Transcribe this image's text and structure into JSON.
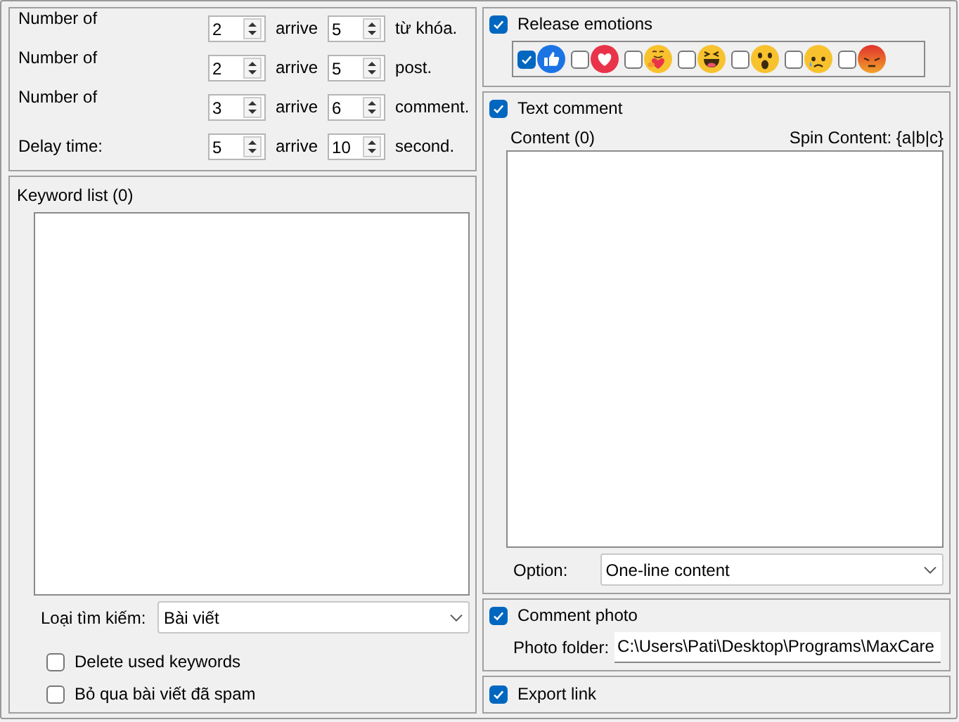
{
  "counts": [
    {
      "label": "Number of",
      "from": "2",
      "joiner": "arrive",
      "to": "5",
      "unit": "từ khóa."
    },
    {
      "label": "Number of",
      "from": "2",
      "joiner": "arrive",
      "to": "5",
      "unit": "post."
    },
    {
      "label": "Number of",
      "from": "3",
      "joiner": "arrive",
      "to": "6",
      "unit": "comment."
    },
    {
      "label": "Delay time:",
      "from": "5",
      "joiner": "arrive",
      "to": "10",
      "unit": "second."
    }
  ],
  "keyword_list": {
    "title": "Keyword list (0)"
  },
  "search_type": {
    "label": "Loại tìm kiếm:",
    "value": "Bài viết"
  },
  "options": [
    {
      "label": "Delete used keywords",
      "checked": false
    },
    {
      "label": "Bỏ qua bài viết đã spam",
      "checked": false
    }
  ],
  "release_emotions": {
    "label": "Release emotions",
    "checked": true,
    "reactions": [
      {
        "kind": "like",
        "checked": true
      },
      {
        "kind": "love",
        "checked": false
      },
      {
        "kind": "care",
        "checked": false
      },
      {
        "kind": "haha",
        "checked": false
      },
      {
        "kind": "wow",
        "checked": false
      },
      {
        "kind": "sad",
        "checked": false
      },
      {
        "kind": "angry",
        "checked": false
      }
    ]
  },
  "text_comment": {
    "label": "Text comment",
    "checked": true,
    "content_label": "Content (0)",
    "spin_hint": "Spin Content: {a|b|c}",
    "option_label": "Option:",
    "option_value": "One-line content"
  },
  "comment_photo": {
    "label": "Comment photo",
    "checked": true,
    "folder_label": "Photo folder:",
    "folder_value": "C:\\Users\\Pati\\Desktop\\Programs\\MaxCare"
  },
  "export_link": {
    "label": "Export link",
    "checked": true
  }
}
